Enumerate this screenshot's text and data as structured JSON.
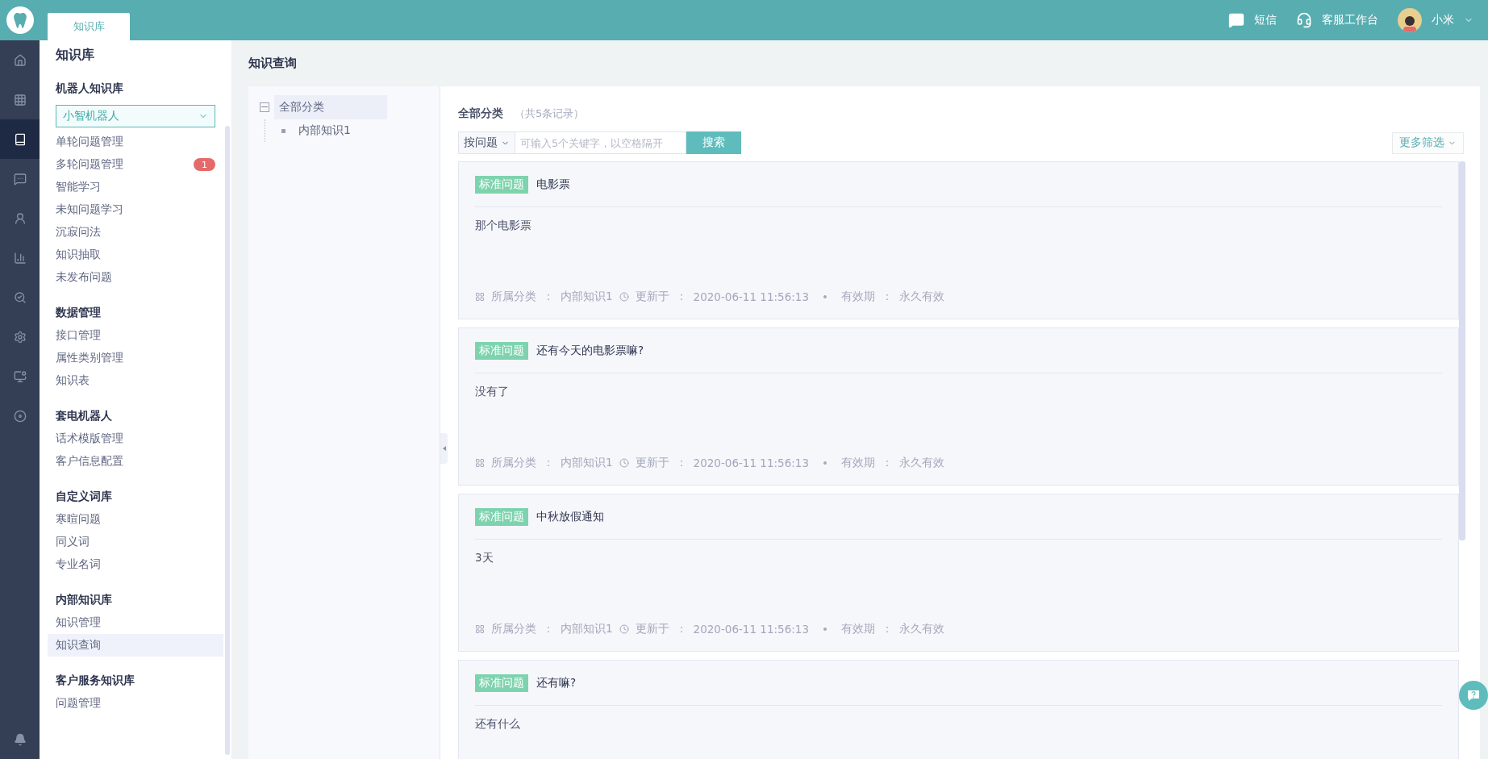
{
  "topbar": {
    "tabs": [
      {
        "label": "知识库",
        "selected": true
      }
    ],
    "sms": "短信",
    "workbench": "客服工作台",
    "user": "小米"
  },
  "rail": {
    "items": [
      {
        "selected": false
      },
      {
        "selected": false
      },
      {
        "selected": true
      },
      {
        "selected": false
      },
      {
        "selected": false
      },
      {
        "selected": false
      },
      {
        "selected": false
      },
      {
        "selected": false
      },
      {
        "selected": false
      },
      {
        "selected": false
      }
    ]
  },
  "sidebar": {
    "title": "知识库",
    "sections": [
      {
        "heading": "机器人知识库",
        "dropdown": "小智机器人",
        "items": [
          {
            "label": "单轮问题管理",
            "selected": false
          },
          {
            "label": "多轮问题管理",
            "selected": false,
            "badge": "1"
          },
          {
            "label": "智能学习",
            "selected": false
          },
          {
            "label": "未知问题学习",
            "selected": false
          },
          {
            "label": "沉寂问法",
            "selected": false
          },
          {
            "label": "知识抽取",
            "selected": false
          },
          {
            "label": "未发布问题",
            "selected": false
          }
        ]
      },
      {
        "heading": "数据管理",
        "items": [
          {
            "label": "接口管理",
            "selected": false
          },
          {
            "label": "属性类别管理",
            "selected": false
          },
          {
            "label": "知识表",
            "selected": false
          }
        ]
      },
      {
        "heading": "套电机器人",
        "items": [
          {
            "label": "话术模版管理",
            "selected": false
          },
          {
            "label": "客户信息配置",
            "selected": false
          }
        ]
      },
      {
        "heading": "自定义词库",
        "items": [
          {
            "label": "寒暄问题",
            "selected": false
          },
          {
            "label": "同义词",
            "selected": false
          },
          {
            "label": "专业名词",
            "selected": false
          }
        ]
      },
      {
        "heading": "内部知识库",
        "items": [
          {
            "label": "知识管理",
            "selected": false
          },
          {
            "label": "知识查询",
            "selected": true
          }
        ]
      },
      {
        "heading": "客户服务知识库",
        "items": [
          {
            "label": "问题管理",
            "selected": false
          }
        ]
      }
    ]
  },
  "content": {
    "title": "知识查询",
    "tree": {
      "label": "全部分类",
      "expanded": true,
      "selected": true,
      "children": [
        {
          "label": "内部知识1",
          "selected": false
        }
      ]
    },
    "list": {
      "title": "全部分类",
      "count": "（共5条记录）",
      "search_mode": "按问题",
      "placeholder": "可输入5个关键字，以空格隔开",
      "search_button": "搜索",
      "filter": "更多筛选",
      "cards": [
        {
          "tag": "标准问题",
          "question": "电影票",
          "answer": "那个电影票",
          "separator": "：",
          "meta": [
            {
              "label": "所属分类",
              "value": "内部知识1"
            },
            {
              "label": "更新于",
              "value": "2020-06-11 11:56:13"
            },
            {
              "label": "有效期",
              "value": "永久有效"
            }
          ]
        },
        {
          "tag": "标准问题",
          "question": "还有今天的电影票嘛?",
          "answer": "没有了",
          "separator": "：",
          "meta": [
            {
              "label": "所属分类",
              "value": "内部知识1"
            },
            {
              "label": "更新于",
              "value": "2020-06-11 11:56:13"
            },
            {
              "label": "有效期",
              "value": "永久有效"
            }
          ]
        },
        {
          "tag": "标准问题",
          "question": "中秋放假通知",
          "answer": "3天",
          "separator": "：",
          "meta": [
            {
              "label": "所属分类",
              "value": "内部知识1"
            },
            {
              "label": "更新于",
              "value": "2020-06-11 11:56:13"
            },
            {
              "label": "有效期",
              "value": "永久有效"
            }
          ]
        },
        {
          "tag": "标准问题",
          "question": "还有嘛?",
          "answer": "还有什么"
        }
      ]
    }
  }
}
